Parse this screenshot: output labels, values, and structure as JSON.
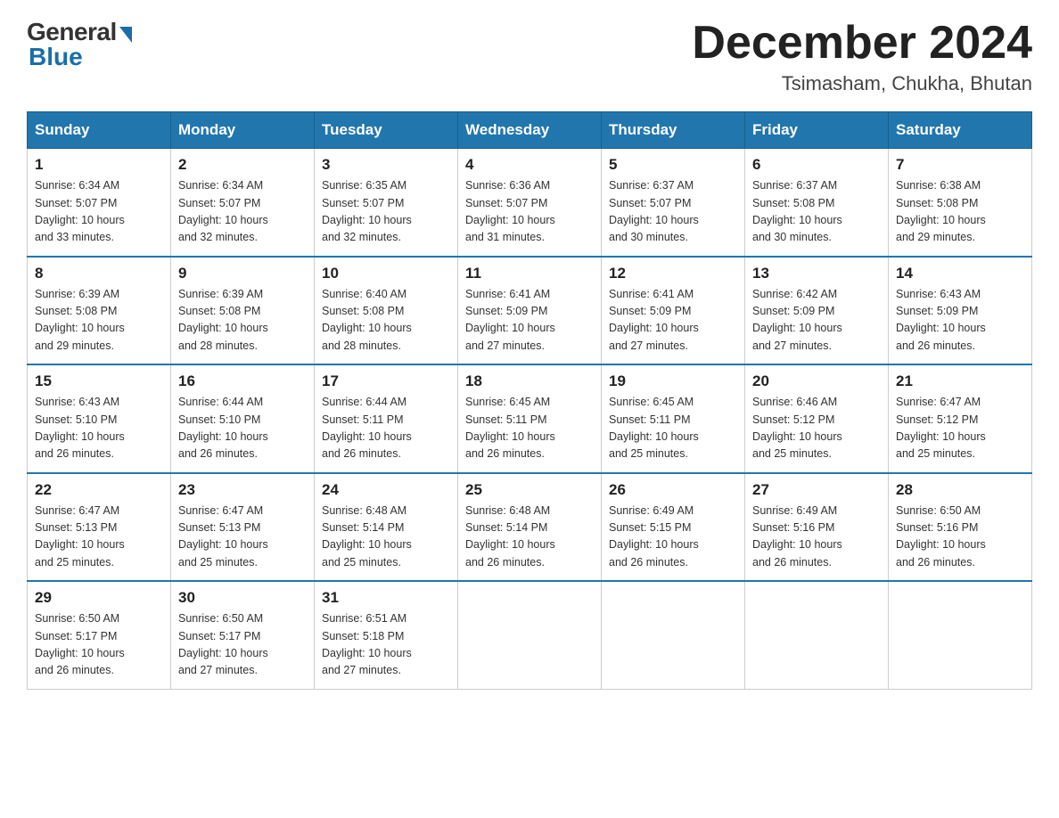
{
  "logo": {
    "general": "General",
    "blue": "Blue"
  },
  "title": "December 2024",
  "subtitle": "Tsimasham, Chukha, Bhutan",
  "days_of_week": [
    "Sunday",
    "Monday",
    "Tuesday",
    "Wednesday",
    "Thursday",
    "Friday",
    "Saturday"
  ],
  "weeks": [
    [
      {
        "day": "1",
        "sunrise": "6:34 AM",
        "sunset": "5:07 PM",
        "daylight": "10 hours and 33 minutes."
      },
      {
        "day": "2",
        "sunrise": "6:34 AM",
        "sunset": "5:07 PM",
        "daylight": "10 hours and 32 minutes."
      },
      {
        "day": "3",
        "sunrise": "6:35 AM",
        "sunset": "5:07 PM",
        "daylight": "10 hours and 32 minutes."
      },
      {
        "day": "4",
        "sunrise": "6:36 AM",
        "sunset": "5:07 PM",
        "daylight": "10 hours and 31 minutes."
      },
      {
        "day": "5",
        "sunrise": "6:37 AM",
        "sunset": "5:07 PM",
        "daylight": "10 hours and 30 minutes."
      },
      {
        "day": "6",
        "sunrise": "6:37 AM",
        "sunset": "5:08 PM",
        "daylight": "10 hours and 30 minutes."
      },
      {
        "day": "7",
        "sunrise": "6:38 AM",
        "sunset": "5:08 PM",
        "daylight": "10 hours and 29 minutes."
      }
    ],
    [
      {
        "day": "8",
        "sunrise": "6:39 AM",
        "sunset": "5:08 PM",
        "daylight": "10 hours and 29 minutes."
      },
      {
        "day": "9",
        "sunrise": "6:39 AM",
        "sunset": "5:08 PM",
        "daylight": "10 hours and 28 minutes."
      },
      {
        "day": "10",
        "sunrise": "6:40 AM",
        "sunset": "5:08 PM",
        "daylight": "10 hours and 28 minutes."
      },
      {
        "day": "11",
        "sunrise": "6:41 AM",
        "sunset": "5:09 PM",
        "daylight": "10 hours and 27 minutes."
      },
      {
        "day": "12",
        "sunrise": "6:41 AM",
        "sunset": "5:09 PM",
        "daylight": "10 hours and 27 minutes."
      },
      {
        "day": "13",
        "sunrise": "6:42 AM",
        "sunset": "5:09 PM",
        "daylight": "10 hours and 27 minutes."
      },
      {
        "day": "14",
        "sunrise": "6:43 AM",
        "sunset": "5:09 PM",
        "daylight": "10 hours and 26 minutes."
      }
    ],
    [
      {
        "day": "15",
        "sunrise": "6:43 AM",
        "sunset": "5:10 PM",
        "daylight": "10 hours and 26 minutes."
      },
      {
        "day": "16",
        "sunrise": "6:44 AM",
        "sunset": "5:10 PM",
        "daylight": "10 hours and 26 minutes."
      },
      {
        "day": "17",
        "sunrise": "6:44 AM",
        "sunset": "5:11 PM",
        "daylight": "10 hours and 26 minutes."
      },
      {
        "day": "18",
        "sunrise": "6:45 AM",
        "sunset": "5:11 PM",
        "daylight": "10 hours and 26 minutes."
      },
      {
        "day": "19",
        "sunrise": "6:45 AM",
        "sunset": "5:11 PM",
        "daylight": "10 hours and 25 minutes."
      },
      {
        "day": "20",
        "sunrise": "6:46 AM",
        "sunset": "5:12 PM",
        "daylight": "10 hours and 25 minutes."
      },
      {
        "day": "21",
        "sunrise": "6:47 AM",
        "sunset": "5:12 PM",
        "daylight": "10 hours and 25 minutes."
      }
    ],
    [
      {
        "day": "22",
        "sunrise": "6:47 AM",
        "sunset": "5:13 PM",
        "daylight": "10 hours and 25 minutes."
      },
      {
        "day": "23",
        "sunrise": "6:47 AM",
        "sunset": "5:13 PM",
        "daylight": "10 hours and 25 minutes."
      },
      {
        "day": "24",
        "sunrise": "6:48 AM",
        "sunset": "5:14 PM",
        "daylight": "10 hours and 25 minutes."
      },
      {
        "day": "25",
        "sunrise": "6:48 AM",
        "sunset": "5:14 PM",
        "daylight": "10 hours and 26 minutes."
      },
      {
        "day": "26",
        "sunrise": "6:49 AM",
        "sunset": "5:15 PM",
        "daylight": "10 hours and 26 minutes."
      },
      {
        "day": "27",
        "sunrise": "6:49 AM",
        "sunset": "5:16 PM",
        "daylight": "10 hours and 26 minutes."
      },
      {
        "day": "28",
        "sunrise": "6:50 AM",
        "sunset": "5:16 PM",
        "daylight": "10 hours and 26 minutes."
      }
    ],
    [
      {
        "day": "29",
        "sunrise": "6:50 AM",
        "sunset": "5:17 PM",
        "daylight": "10 hours and 26 minutes."
      },
      {
        "day": "30",
        "sunrise": "6:50 AM",
        "sunset": "5:17 PM",
        "daylight": "10 hours and 27 minutes."
      },
      {
        "day": "31",
        "sunrise": "6:51 AM",
        "sunset": "5:18 PM",
        "daylight": "10 hours and 27 minutes."
      },
      null,
      null,
      null,
      null
    ]
  ],
  "labels": {
    "sunrise": "Sunrise:",
    "sunset": "Sunset:",
    "daylight": "Daylight:"
  }
}
